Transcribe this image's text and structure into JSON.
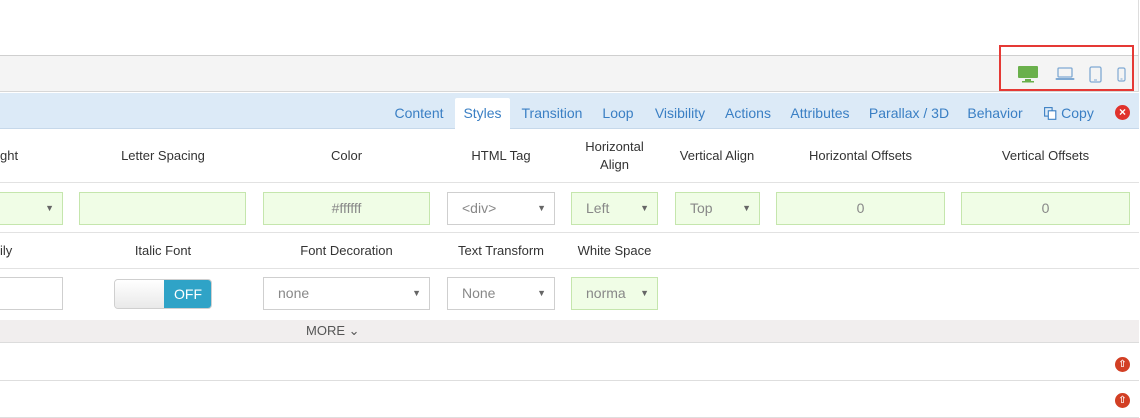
{
  "devices": {
    "items": [
      {
        "name": "desktop",
        "color": "#6ab04c"
      },
      {
        "name": "laptop",
        "color": "#7fa9d3"
      },
      {
        "name": "tablet",
        "color": "#7fa9d3"
      },
      {
        "name": "mobile",
        "color": "#7fa9d3"
      }
    ],
    "highlight_color": "#e53935"
  },
  "tabs": [
    {
      "label": "Content",
      "active": false
    },
    {
      "label": "Styles",
      "active": true
    },
    {
      "label": "Transition",
      "active": false
    },
    {
      "label": "Loop",
      "active": false
    },
    {
      "label": "Visibility",
      "active": false
    },
    {
      "label": "Actions",
      "active": false
    },
    {
      "label": "Attributes",
      "active": false
    },
    {
      "label": "Parallax / 3D",
      "active": false
    },
    {
      "label": "Behavior",
      "active": false
    },
    {
      "label": "Copy",
      "active": false,
      "icon": "copy-icon"
    }
  ],
  "close_icon": "×",
  "row1": {
    "labels": {
      "font_weight": "ght",
      "letter_spacing": "Letter Spacing",
      "color": "Color",
      "html_tag": "HTML Tag",
      "h_align_1": "Horizontal",
      "h_align_2": "Align",
      "v_align": "Vertical Align",
      "h_offsets": "Horizontal Offsets",
      "v_offsets": "Vertical Offsets"
    },
    "values": {
      "font_weight": "",
      "letter_spacing": "",
      "color": "#ffffff",
      "html_tag": "<div>",
      "h_align": "Left",
      "v_align": "Top",
      "h_offsets": "0",
      "v_offsets": "0"
    }
  },
  "row2": {
    "labels": {
      "font_family": "ily",
      "italic_font": "Italic Font",
      "font_decoration": "Font Decoration",
      "text_transform": "Text Transform",
      "white_space": "White Space"
    },
    "values": {
      "font_family": "",
      "italic_toggle": "OFF",
      "font_decoration": "none",
      "text_transform": "None",
      "white_space": "norma"
    }
  },
  "more_label": "MORE ⌄",
  "caret": "▼",
  "up_icon": "⇧",
  "accent": "#3a7fc4",
  "green": "#6ab04c"
}
